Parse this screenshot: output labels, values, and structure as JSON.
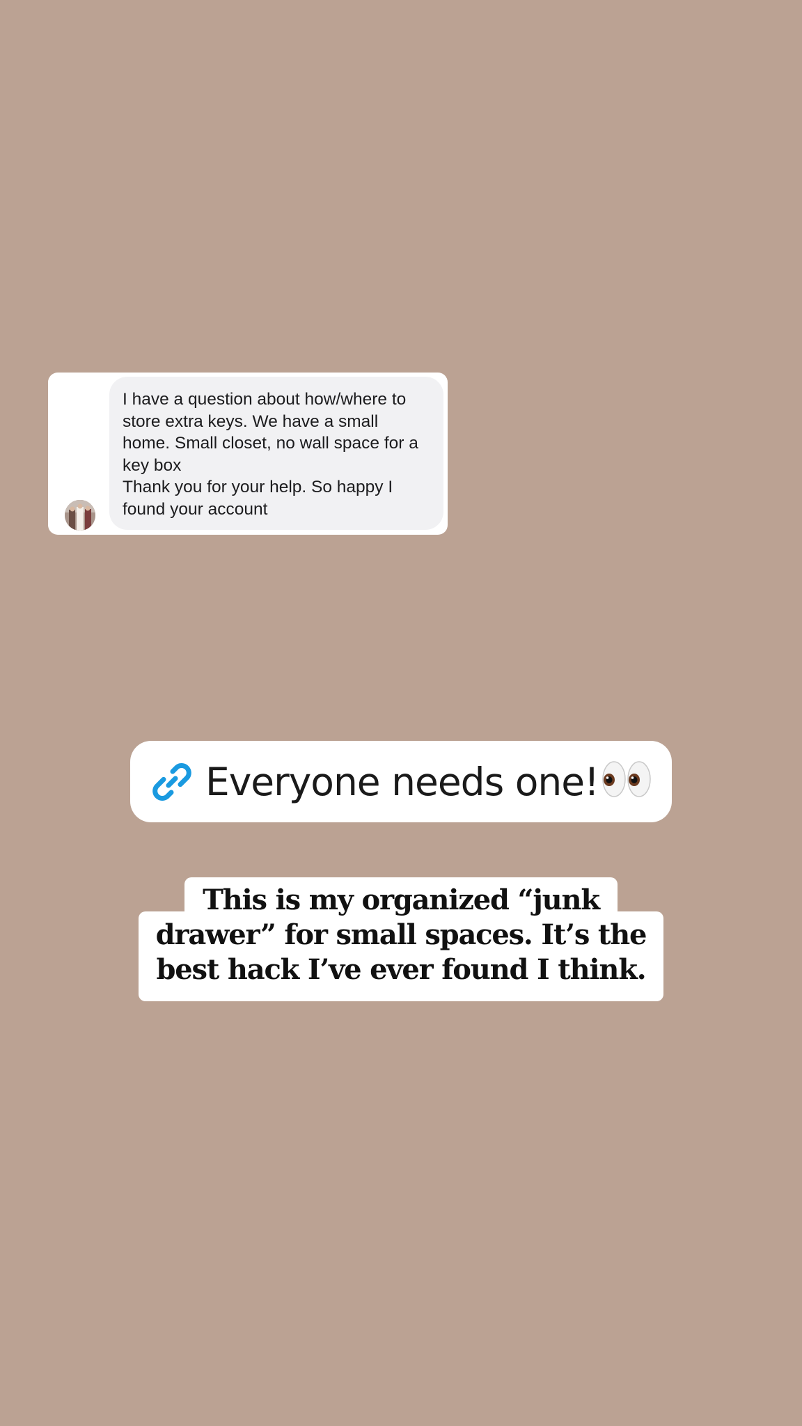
{
  "story": {
    "background_color": "#bba293"
  },
  "dm_card": {
    "message_lines": [
      "I have a question about how/where to",
      "store extra keys.  We have a small",
      "home. Small closet, no wall space for a",
      "key box",
      "Thank you for your help.  So happy I",
      "found your account"
    ],
    "bubble_color": "#f1f1f3"
  },
  "link_sticker": {
    "label": "Everyone needs one!",
    "icon": "link-icon",
    "emoji": "eyes-emoji",
    "accent_color": "#1a9ae0"
  },
  "caption": {
    "lines": [
      "This is my organized “junk",
      "drawer” for small spaces. It’s the",
      "best hack I’ve ever found I think."
    ]
  }
}
